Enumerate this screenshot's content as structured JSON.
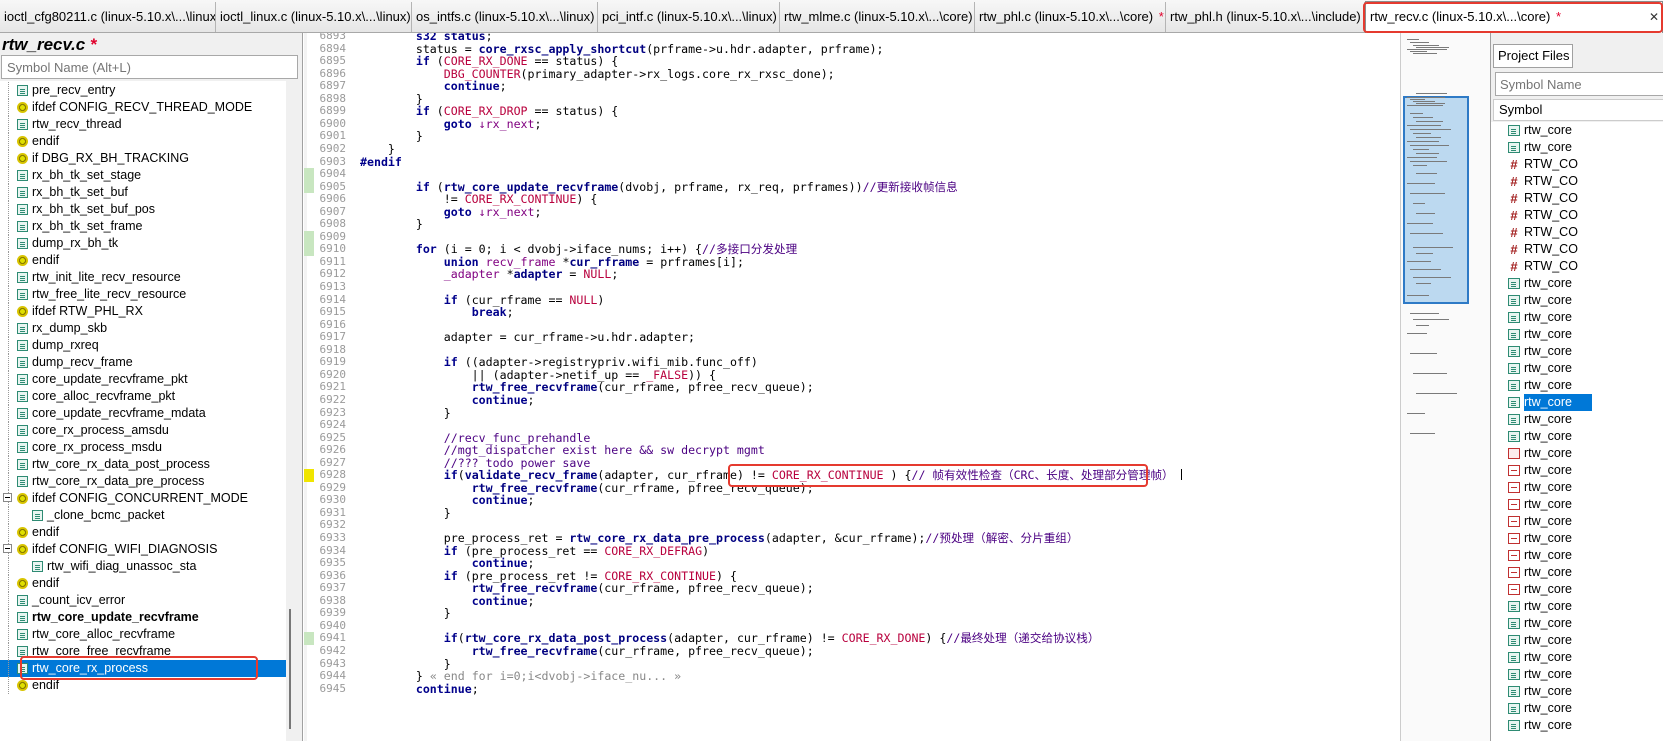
{
  "tabs": [
    {
      "label": "ioctl_cfg80211.c (linux-5.10.x\\...\\linux)",
      "modified": false,
      "active": false
    },
    {
      "label": "ioctl_linux.c (linux-5.10.x\\...\\linux)",
      "modified": false,
      "active": false
    },
    {
      "label": "os_intfs.c (linux-5.10.x\\...\\linux)",
      "modified": false,
      "active": false
    },
    {
      "label": "pci_intf.c (linux-5.10.x\\...\\linux)",
      "modified": false,
      "active": false
    },
    {
      "label": "rtw_mlme.c (linux-5.10.x\\...\\core)",
      "modified": false,
      "active": false
    },
    {
      "label": "rtw_phl.c (linux-5.10.x\\...\\core)",
      "modified": true,
      "active": false
    },
    {
      "label": "rtw_phl.h (linux-5.10.x\\...\\include)",
      "modified": false,
      "active": false
    },
    {
      "label": "rtw_recv.c (linux-5.10.x\\...\\core)",
      "modified": true,
      "active": true
    }
  ],
  "modified_marker": "*",
  "close_glyph": "✕",
  "left_panel": {
    "file_title": "rtw_recv.c",
    "search_placeholder": "Symbol Name (Alt+L)",
    "symbols": [
      {
        "label": "pre_recv_entry",
        "kind": "func",
        "indent": 1
      },
      {
        "label": "ifdef CONFIG_RECV_THREAD_MODE",
        "kind": "macro",
        "indent": 1
      },
      {
        "label": "rtw_recv_thread",
        "kind": "func",
        "indent": 1
      },
      {
        "label": "endif",
        "kind": "macro",
        "indent": 1
      },
      {
        "label": "if DBG_RX_BH_TRACKING",
        "kind": "macro",
        "indent": 1
      },
      {
        "label": "rx_bh_tk_set_stage",
        "kind": "func",
        "indent": 1
      },
      {
        "label": "rx_bh_tk_set_buf",
        "kind": "func",
        "indent": 1
      },
      {
        "label": "rx_bh_tk_set_buf_pos",
        "kind": "func",
        "indent": 1
      },
      {
        "label": "rx_bh_tk_set_frame",
        "kind": "func",
        "indent": 1
      },
      {
        "label": "dump_rx_bh_tk",
        "kind": "func",
        "indent": 1
      },
      {
        "label": "endif",
        "kind": "macro",
        "indent": 1
      },
      {
        "label": "rtw_init_lite_recv_resource",
        "kind": "func",
        "indent": 1
      },
      {
        "label": "rtw_free_lite_recv_resource",
        "kind": "func",
        "indent": 1
      },
      {
        "label": "ifdef RTW_PHL_RX",
        "kind": "macro",
        "indent": 1
      },
      {
        "label": "rx_dump_skb",
        "kind": "func",
        "indent": 1
      },
      {
        "label": "dump_rxreq",
        "kind": "func",
        "indent": 1
      },
      {
        "label": "dump_recv_frame",
        "kind": "func",
        "indent": 1
      },
      {
        "label": "core_update_recvframe_pkt",
        "kind": "func",
        "indent": 1
      },
      {
        "label": "core_alloc_recvframe_pkt",
        "kind": "func",
        "indent": 1
      },
      {
        "label": "core_update_recvframe_mdata",
        "kind": "func",
        "indent": 1
      },
      {
        "label": "core_rx_process_amsdu",
        "kind": "func",
        "indent": 1
      },
      {
        "label": "core_rx_process_msdu",
        "kind": "func",
        "indent": 1
      },
      {
        "label": "rtw_core_rx_data_post_process",
        "kind": "func",
        "indent": 1
      },
      {
        "label": "rtw_core_rx_data_pre_process",
        "kind": "func",
        "indent": 1
      },
      {
        "label": "ifdef CONFIG_CONCURRENT_MODE",
        "kind": "macro",
        "indent": 1,
        "expander": true
      },
      {
        "label": "_clone_bcmc_packet",
        "kind": "func",
        "indent": 2
      },
      {
        "label": "endif",
        "kind": "macro",
        "indent": 1
      },
      {
        "label": "ifdef CONFIG_WIFI_DIAGNOSIS",
        "kind": "macro",
        "indent": 1,
        "expander": true
      },
      {
        "label": "rtw_wifi_diag_unassoc_sta",
        "kind": "func",
        "indent": 2
      },
      {
        "label": "endif",
        "kind": "macro",
        "indent": 1
      },
      {
        "label": "_count_icv_error",
        "kind": "func",
        "indent": 1
      },
      {
        "label": "rtw_core_update_recvframe",
        "kind": "func",
        "indent": 1,
        "bold": true
      },
      {
        "label": "rtw_core_alloc_recvframe",
        "kind": "func",
        "indent": 1
      },
      {
        "label": "rtw_core_free_recvframe",
        "kind": "func",
        "indent": 1
      },
      {
        "label": "rtw_core_rx_process",
        "kind": "func",
        "indent": 1,
        "selected": true
      },
      {
        "label": "endif",
        "kind": "macro",
        "indent": 1
      }
    ]
  },
  "editor": {
    "lines": [
      {
        "n": 6893,
        "html": "        <span class='kw'>s32</span> <span class='fn'>status</span>;"
      },
      {
        "n": 6894,
        "html": "        status = <span class='fn'>core_rxsc_apply_shortcut</span>(prframe-&gt;u.hdr.adapter, prframe);"
      },
      {
        "n": 6895,
        "html": "        <span class='kw'>if</span> (<span class='mac'>CORE_RX_DONE</span> == status) {"
      },
      {
        "n": 6896,
        "html": "            <span class='mac'>DBG_COUNTER</span>(primary_adapter-&gt;rx_logs.core_rx_rxsc_done);"
      },
      {
        "n": 6897,
        "html": "            <span class='kw'>continue</span>;"
      },
      {
        "n": 6898,
        "html": "        }"
      },
      {
        "n": 6899,
        "html": "        <span class='kw'>if</span> (<span class='mac'>CORE_RX_DROP</span> == status) {"
      },
      {
        "n": 6900,
        "html": "            <span class='kw'>goto</span> <span class='ty'>↓rx_next</span>;"
      },
      {
        "n": 6901,
        "html": "        }"
      },
      {
        "n": 6902,
        "html": "    }"
      },
      {
        "n": 6903,
        "html": "<span class='kw'>#endif</span>"
      },
      {
        "n": 6904,
        "html": ""
      },
      {
        "n": 6905,
        "html": "        <span class='kw'>if</span> (<span class='fn'>rtw_core_update_recvframe</span>(dvobj, prframe, rx_req, prframes))<span class='cm'>//更新接收帧信息</span>"
      },
      {
        "n": 6906,
        "html": "            != <span class='mac'>CORE_RX_CONTINUE</span>) {"
      },
      {
        "n": 6907,
        "html": "            <span class='kw'>goto</span> <span class='ty'>↓rx_next</span>;"
      },
      {
        "n": 6908,
        "html": "        }"
      },
      {
        "n": 6909,
        "html": ""
      },
      {
        "n": 6910,
        "html": "        <span class='kw'>for</span> (i = 0; i &lt; dvobj-&gt;iface_nums; i++) {<span class='cm'>//多接口分发处理</span>"
      },
      {
        "n": 6911,
        "html": "            <span class='kw'>union</span> <span class='ty'>recv_frame</span> *<span class='fn'>cur_rframe</span> = prframes[i];"
      },
      {
        "n": 6912,
        "html": "            <span class='ty'>_adapter</span> *<span class='fn'>adapter</span> = <span class='mac'>NULL</span>;"
      },
      {
        "n": 6913,
        "html": ""
      },
      {
        "n": 6914,
        "html": "            <span class='kw'>if</span> (cur_rframe == <span class='mac'>NULL</span>)"
      },
      {
        "n": 6915,
        "html": "                <span class='kw'>break</span>;"
      },
      {
        "n": 6916,
        "html": ""
      },
      {
        "n": 6917,
        "html": "            adapter = cur_rframe-&gt;u.hdr.adapter;"
      },
      {
        "n": 6918,
        "html": ""
      },
      {
        "n": 6919,
        "html": "            <span class='kw'>if</span> ((adapter-&gt;registrypriv.wifi_mib.func_off)"
      },
      {
        "n": 6920,
        "html": "                || (adapter-&gt;netif_up == <span class='mac'>_FALSE</span>)) {"
      },
      {
        "n": 6921,
        "html": "                <span class='fn'>rtw_free_recvframe</span>(cur_rframe, pfree_recv_queue);"
      },
      {
        "n": 6922,
        "html": "                <span class='kw'>continue</span>;"
      },
      {
        "n": 6923,
        "html": "            }"
      },
      {
        "n": 6924,
        "html": ""
      },
      {
        "n": 6925,
        "html": "            <span class='cm'>//recv_func_prehandle</span>"
      },
      {
        "n": 6926,
        "html": "            <span class='cm'>//mgt_dispatcher exist here &amp;&amp; sw decrypt mgmt</span>"
      },
      {
        "n": 6927,
        "html": "            <span class='cm'>//??? todo power save</span>"
      },
      {
        "n": 6928,
        "html": "            <span class='kw'>if</span>(<span class='fn'>validate_recv_frame</span>(adapter, cur_rframe) != <span class='mac'>CORE_RX_CONTINUE</span> ) {<span class='cm'>// 帧有效性检查（CRC、长度、处理部分管理帧）</span> <span class='caret'></span>"
      },
      {
        "n": 6929,
        "html": "                <span class='fn'>rtw_free_recvframe</span>(cur_rframe, pfree_recv_queue);"
      },
      {
        "n": 6930,
        "html": "                <span class='kw'>continue</span>;"
      },
      {
        "n": 6931,
        "html": "            }"
      },
      {
        "n": 6932,
        "html": ""
      },
      {
        "n": 6933,
        "html": "            pre_process_ret = <span class='fn'>rtw_core_rx_data_pre_process</span>(adapter, &amp;cur_rframe);<span class='cm'>//预处理（解密、分片重组）</span>"
      },
      {
        "n": 6934,
        "html": "            <span class='kw'>if</span> (pre_process_ret == <span class='mac'>CORE_RX_DEFRAG</span>)"
      },
      {
        "n": 6935,
        "html": "                <span class='kw'>continue</span>;"
      },
      {
        "n": 6936,
        "html": "            <span class='kw'>if</span> (pre_process_ret != <span class='mac'>CORE_RX_CONTINUE</span>) {"
      },
      {
        "n": 6937,
        "html": "                <span class='fn'>rtw_free_recvframe</span>(cur_rframe, pfree_recv_queue);"
      },
      {
        "n": 6938,
        "html": "                <span class='kw'>continue</span>;"
      },
      {
        "n": 6939,
        "html": "            }"
      },
      {
        "n": 6940,
        "html": ""
      },
      {
        "n": 6941,
        "html": "            <span class='kw'>if</span>(<span class='fn'>rtw_core_rx_data_post_process</span>(adapter, cur_rframe) != <span class='mac'>CORE_RX_DONE</span>) {<span class='cm'>//最终处理（递交给协议栈）</span>"
      },
      {
        "n": 6942,
        "html": "                <span class='fn'>rtw_free_recvframe</span>(cur_rframe, pfree_recv_queue);"
      },
      {
        "n": 6943,
        "html": "            }"
      },
      {
        "n": 6944,
        "html": "        } <span style='color:#888'>« end for i=0;i&lt;dvobj-&gt;iface_nu... »</span>"
      },
      {
        "n": 6945,
        "html": "        <span class='kw'>continue</span>;"
      }
    ],
    "added_marks": [
      6904,
      6905,
      6909,
      6910,
      6941
    ],
    "current_line": 6928
  },
  "right_panel": {
    "tab_label": "Project Files",
    "search_placeholder": "Symbol Name",
    "header": "Symbol",
    "items": [
      {
        "label": "rtw_core",
        "kind": "func"
      },
      {
        "label": "rtw_core",
        "kind": "func"
      },
      {
        "label": "RTW_CO",
        "kind": "hash"
      },
      {
        "label": "RTW_CO",
        "kind": "hash"
      },
      {
        "label": "RTW_CO",
        "kind": "hash"
      },
      {
        "label": "RTW_CO",
        "kind": "hash"
      },
      {
        "label": "RTW_CO",
        "kind": "hash"
      },
      {
        "label": "RTW_CO",
        "kind": "hash"
      },
      {
        "label": "RTW_CO",
        "kind": "hash"
      },
      {
        "label": "rtw_core",
        "kind": "func"
      },
      {
        "label": "rtw_core",
        "kind": "func"
      },
      {
        "label": "rtw_core",
        "kind": "func"
      },
      {
        "label": "rtw_core",
        "kind": "func"
      },
      {
        "label": "rtw_core",
        "kind": "func"
      },
      {
        "label": "rtw_core",
        "kind": "func"
      },
      {
        "label": "rtw_core",
        "kind": "func"
      },
      {
        "label": "rtw_core",
        "kind": "func",
        "selected": true
      },
      {
        "label": "rtw_core",
        "kind": "func"
      },
      {
        "label": "rtw_core",
        "kind": "func"
      },
      {
        "label": "rtw_core",
        "kind": "struct"
      },
      {
        "label": "rtw_core",
        "kind": "def"
      },
      {
        "label": "rtw_core",
        "kind": "def"
      },
      {
        "label": "rtw_core",
        "kind": "def"
      },
      {
        "label": "rtw_core",
        "kind": "def"
      },
      {
        "label": "rtw_core",
        "kind": "def"
      },
      {
        "label": "rtw_core",
        "kind": "def"
      },
      {
        "label": "rtw_core",
        "kind": "def"
      },
      {
        "label": "rtw_core",
        "kind": "def"
      },
      {
        "label": "rtw_core",
        "kind": "func"
      },
      {
        "label": "rtw_core",
        "kind": "func"
      },
      {
        "label": "rtw_core",
        "kind": "func"
      },
      {
        "label": "rtw_core",
        "kind": "func"
      },
      {
        "label": "rtw_core",
        "kind": "func"
      },
      {
        "label": "rtw_core",
        "kind": "func"
      },
      {
        "label": "rtw_core",
        "kind": "func"
      },
      {
        "label": "rtw_core",
        "kind": "func"
      }
    ]
  }
}
